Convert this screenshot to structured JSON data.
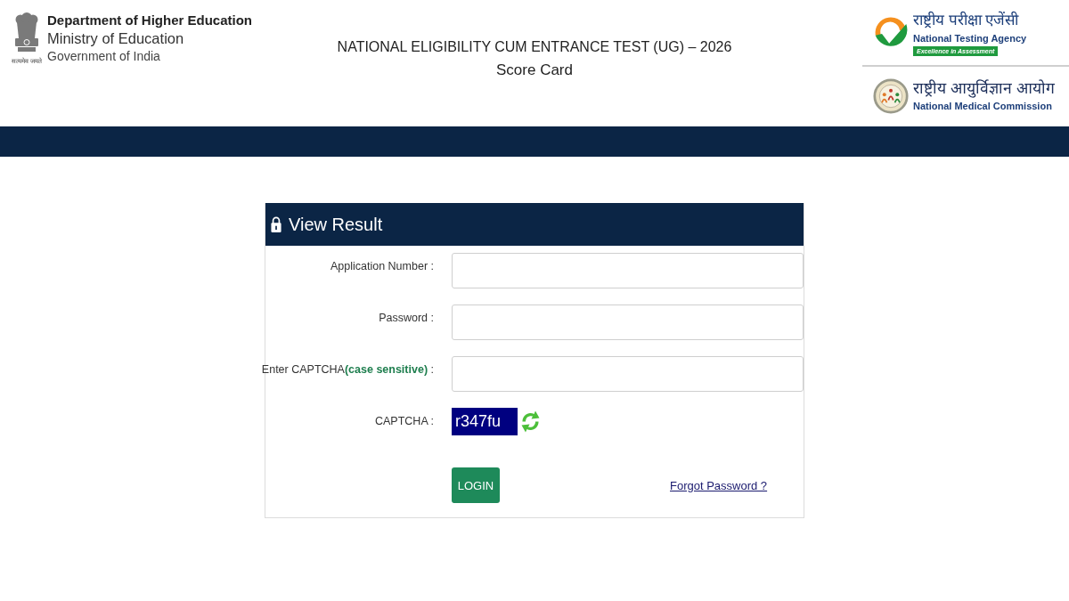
{
  "header": {
    "emblem_motto": "सत्यमेव जयते",
    "department": "Department of Higher Education",
    "ministry": "Ministry of Education",
    "government": "Government of India",
    "title": "NATIONAL ELIGIBILITY CUM ENTRANCE TEST (UG) – 2026",
    "subtitle": "Score Card",
    "logos": [
      {
        "kind": "nta",
        "name_hindi": "राष्ट्रीय परीक्षा एजेंसी",
        "name": "National Testing Agency",
        "tagline": "Excellence in Assessment"
      },
      {
        "kind": "nmc",
        "name_hindi": "राष्ट्रीय आयुर्विज्ञान आयोग",
        "name": "National Medical Commission"
      }
    ]
  },
  "result_form": {
    "title": "View Result",
    "fields": [
      {
        "kind": "input",
        "label": "Application Number :"
      },
      {
        "kind": "input",
        "label": "Password :"
      },
      {
        "kind": "input",
        "label": "Enter CAPTCHA**(case sensitive)** :"
      },
      {
        "kind": "captcha",
        "label": "CAPTCHA :",
        "code": "r347fu"
      }
    ],
    "login_button": "LOGIN",
    "forgot_password_link": "Forgot Password ?"
  }
}
